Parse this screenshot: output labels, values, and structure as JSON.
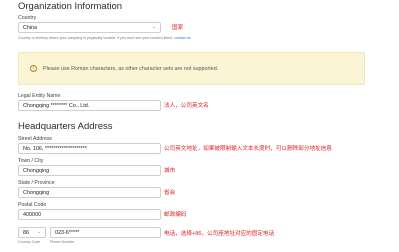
{
  "org": {
    "heading": "Organization Information",
    "country_label": "Country",
    "country_value": "China",
    "country_note": "Country or territory where your company is physically located. If you don't see your location listed,",
    "country_note_link": "contact us",
    "country_annotation": "国家"
  },
  "warning": {
    "text": "Please use Roman characters, as other character sets are not supported."
  },
  "legal": {
    "label": "Legal Entity Name",
    "value": "Chongqing ******** Co., Ltd.",
    "annotation": "法人，公司英文名"
  },
  "hq": {
    "heading": "Headquarters Address",
    "street_label": "Street Address",
    "street_value": "No. 106, ********************",
    "street_annotation": "公司英文地址，如果被限制输入文本长度时，可以删除部分地址信息",
    "city_label": "Town / City",
    "city_value": "Chongqing",
    "city_annotation": "城市",
    "state_label": "State / Province",
    "state_value": "Chongqing",
    "state_annotation": "省会",
    "postal_label": "Postal Code",
    "postal_value": "400000",
    "postal_annotation": "邮政编码",
    "country_code_value": "86",
    "phone_value": "023-6*****",
    "phone_annotation": "电话，选择+86，公司座地址对应的固定电话",
    "country_code_label": "Country Code",
    "phone_label": "Phone Number"
  },
  "colors": {
    "annotation": "#d81e1e",
    "warning_bg": "#fbf5d6",
    "link": "#2f6fd1",
    "chevron": "#4aa0e0"
  },
  "icons": {
    "select_chevron": "chevron-down-icon",
    "warning": "warning-icon"
  }
}
